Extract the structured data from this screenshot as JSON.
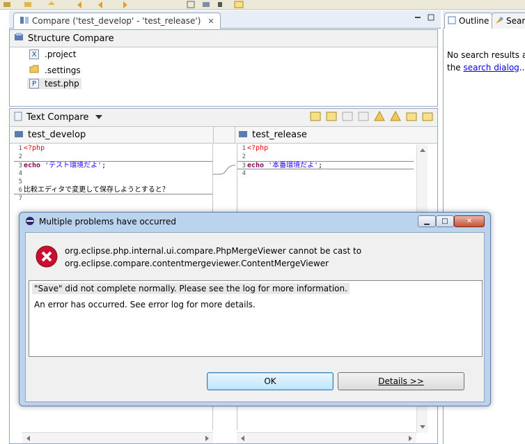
{
  "editor_tab": {
    "title": "Compare ('test_develop' - 'test_release')"
  },
  "right_tabs": {
    "outline": "Outline",
    "search": "Searc"
  },
  "search_panel": {
    "no_results": "No search results a",
    "the": "the ",
    "link": "search dialog",
    "ellipsis": "..."
  },
  "structure_compare": {
    "header": "Structure Compare",
    "files": [
      {
        "name": ".project",
        "icon": "xml-file-icon"
      },
      {
        "name": ".settings",
        "icon": "folder-icon"
      },
      {
        "name": "test.php",
        "icon": "php-file-icon"
      }
    ]
  },
  "text_compare": {
    "header": "Text Compare"
  },
  "left_pane": {
    "title": "test_develop",
    "lines": [
      {
        "num": "1",
        "php": "<?php"
      },
      {
        "num": "2"
      },
      {
        "num": "3",
        "kw": "echo",
        "str": "'テスト環境だよ'",
        "rest": ";"
      },
      {
        "num": "4"
      },
      {
        "num": "5"
      },
      {
        "num": "6",
        "text": "比較エディタで変更して保存しようとすると？"
      },
      {
        "num": "7"
      }
    ]
  },
  "right_pane": {
    "title": "test_release",
    "lines": [
      {
        "num": "1",
        "php": "<?php"
      },
      {
        "num": "2"
      },
      {
        "num": "3",
        "kw": "echo",
        "str": "'本番環境だよ'",
        "rest": ";"
      },
      {
        "num": "4"
      }
    ]
  },
  "dialog": {
    "title": "Multiple problems have occurred",
    "message_line1": "org.eclipse.php.internal.ui.compare.PhpMergeViewer cannot be cast to",
    "message_line2": "org.eclipse.compare.contentmergeviewer.ContentMergeViewer",
    "details": [
      "\"Save\" did not complete normally.  Please see the log for more information.",
      "An error has occurred. See error log for more details."
    ],
    "ok_label": "OK",
    "details_label": "Details >>"
  },
  "colors": {
    "accent": "#3c7fb1",
    "error": "#c8102e",
    "link": "#0000ee"
  }
}
